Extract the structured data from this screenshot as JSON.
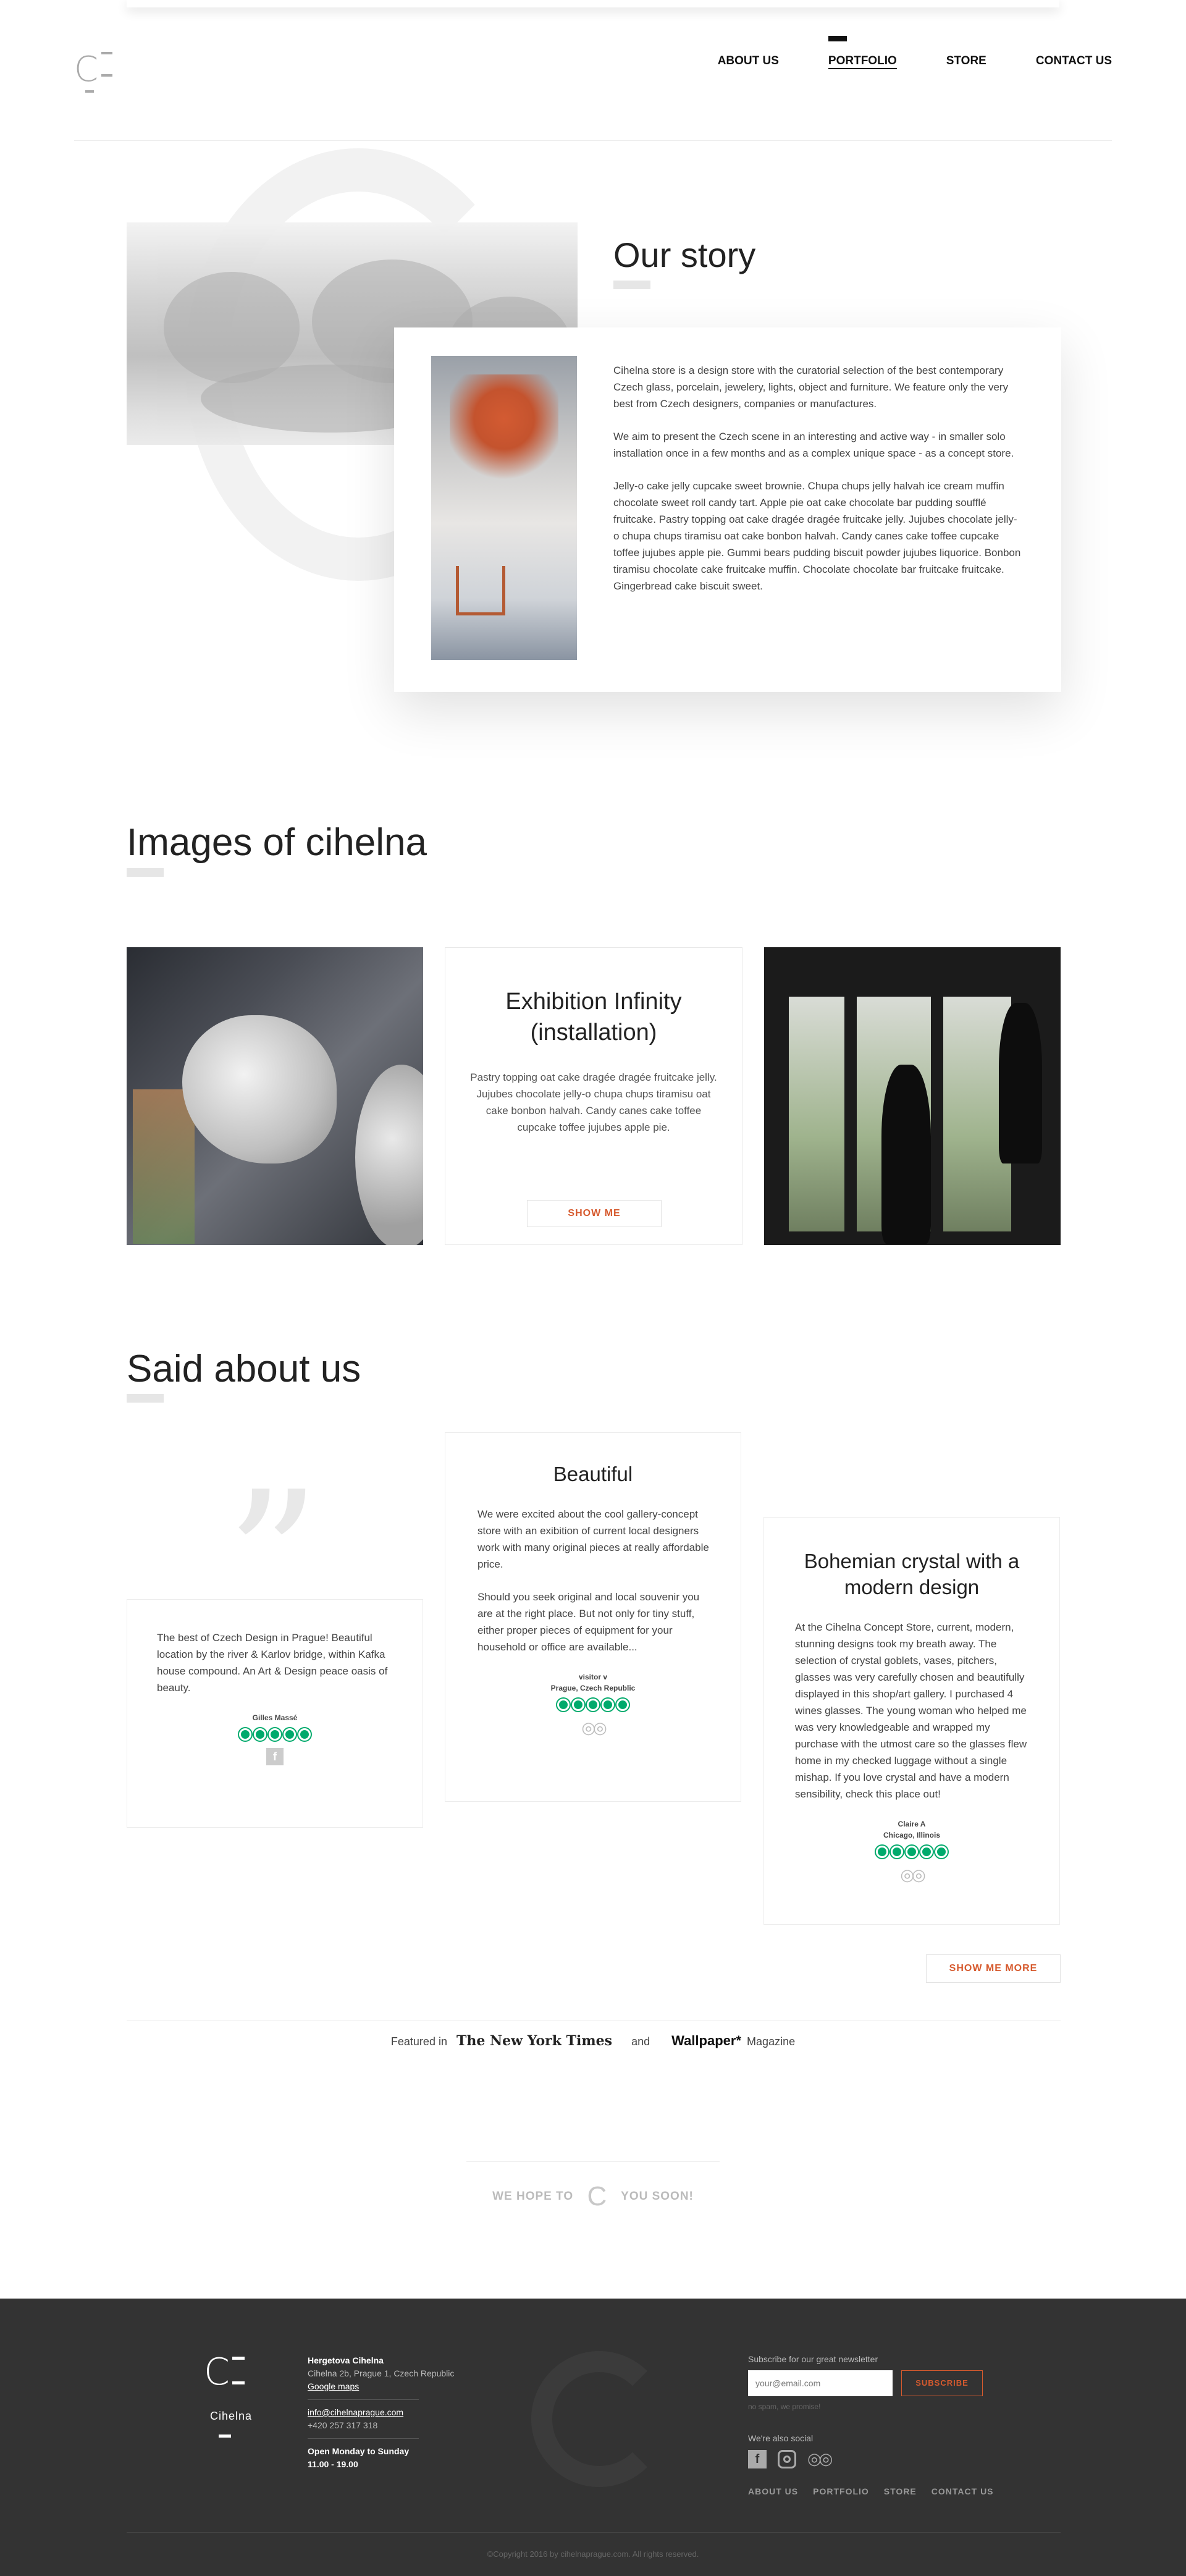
{
  "nav": {
    "items": [
      {
        "label": "ABOUT US"
      },
      {
        "label": "PORTFOLIO"
      },
      {
        "label": "STORE"
      },
      {
        "label": "CONTACT US"
      }
    ]
  },
  "story": {
    "title": "Our story",
    "paragraphs": [
      "Cihelna store is a design store with the curatorial selection of the best contemporary Czech glass, porcelain, jewelery, lights, object and furniture. We feature only the very best from Czech designers, companies or manufactures.",
      "We aim to present the Czech scene in an interesting and active way - in smaller solo installation once in a few months and as a complex unique space - as a concept store.",
      "Jelly-o cake jelly cupcake sweet brownie. Chupa chups jelly halvah ice cream muffin chocolate sweet roll candy tart. Apple pie oat cake chocolate bar pudding soufflé fruitcake. Pastry topping oat cake dragée dragée fruitcake jelly. Jujubes chocolate jelly-o chupa chups tiramisu oat cake bonbon halvah. Candy canes cake toffee cupcake toffee jujubes apple pie. Gummi bears pudding biscuit powder jujubes liquorice. Bonbon tiramisu chocolate cake fruitcake muffin. Chocolate chocolate bar fruitcake fruitcake. Gingerbread cake biscuit sweet."
    ]
  },
  "images_section": {
    "title": "Images of cihelna",
    "card": {
      "title_line1": "Exhibition Infinity",
      "title_line2": "(installation)",
      "text": "Pastry topping oat cake dragée dragée fruitcake jelly. Jujubes chocolate jelly-o chupa chups tiramisu oat cake bonbon halvah. Candy canes cake toffee cupcake toffee jujubes apple pie.",
      "button": "SHOW ME"
    }
  },
  "testimonials": {
    "title": "Said about us",
    "items": [
      {
        "title": "",
        "paragraphs": [
          "The best of Czech Design in Prague! Beautiful location by the river & Karlov bridge, within Kafka house compound. An Art & Design peace oasis of beauty."
        ],
        "author": "Gilles Massé",
        "location": "",
        "stars": 5,
        "source_icon": "facebook-icon"
      },
      {
        "title": "Beautiful",
        "paragraphs": [
          "We were excited about the cool gallery-concept store with an exibition of current local designers work with many original pieces at really affordable price.",
          "Should you seek original and local souvenir you are at the right place. But not only for tiny stuff, either proper pieces of equipment for your household or office are available..."
        ],
        "author": "visitor v",
        "location": "Prague, Czech Republic",
        "stars": 5,
        "source_icon": "tripadvisor-icon"
      },
      {
        "title": "Bohemian crystal with a modern design",
        "paragraphs": [
          "At the Cihelna Concept Store, current, modern, stunning designs took my breath away. The selection of crystal goblets, vases, pitchers, glasses was very carefully chosen and beautifully displayed in this shop/art gallery. I purchased 4 wines glasses. The young woman who helped me was very knowledgeable and wrapped my purchase with the utmost care so the glasses flew home in my checked luggage without a single mishap. If you love crystal and have a modern sensibility, check this place out!"
        ],
        "author": "Claire A",
        "location": "Chicago, Illinois",
        "stars": 5,
        "source_icon": "tripadvisor-icon"
      }
    ],
    "more_button": "SHOW ME MORE"
  },
  "featured": {
    "prefix": "Featured in",
    "publication1": "The New York Times",
    "conjunction": "and",
    "publication2": "Wallpaper*",
    "suffix": "Magazine"
  },
  "hope": {
    "before": "WE HOPE TO",
    "after": "YOU SOON!"
  },
  "footer": {
    "brand": "Cihelna",
    "company": "Hergetova Cihelna",
    "address": "Cihelna 2b, Prague 1, Czech Republic",
    "maps_link": "Google maps",
    "email": "info@cihelnaprague.com",
    "phone": "+420 257 317 318",
    "hours_label": "Open Monday to Sunday",
    "hours": "11.00 - 19.00",
    "newsletter_label": "Subscribe for our great newsletter",
    "email_placeholder": "your@email.com",
    "subscribe_button": "SUBSCRIBE",
    "no_spam": "no spam, we promise!",
    "social_label": "We're also social",
    "links": [
      "ABOUT US",
      "PORTFOLIO",
      "STORE",
      "CONTACT US"
    ],
    "copyright": "©Copyright 2016 by cihelnaprague.com. All rights reserved."
  },
  "colors": {
    "accent": "#d65a2e",
    "rating": "#00aa6c",
    "footer_bg": "#333333"
  }
}
